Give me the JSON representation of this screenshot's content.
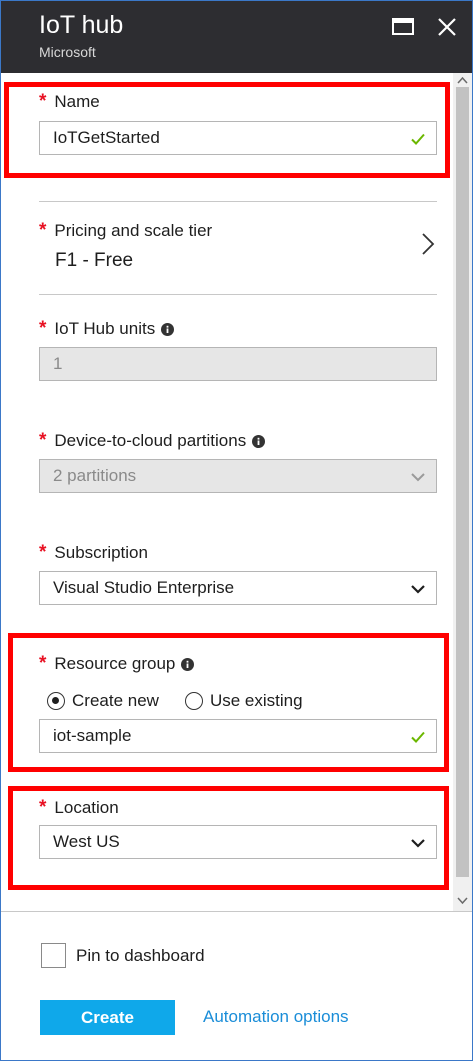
{
  "header": {
    "title": "IoT hub",
    "subtitle": "Microsoft"
  },
  "form": {
    "name": {
      "label": "Name",
      "value": "IoTGetStarted"
    },
    "pricing": {
      "label": "Pricing and scale tier",
      "value": "F1 - Free"
    },
    "units": {
      "label": "IoT Hub units",
      "value": "1"
    },
    "partitions": {
      "label": "Device-to-cloud partitions",
      "value": "2 partitions"
    },
    "subscription": {
      "label": "Subscription",
      "value": "Visual Studio Enterprise"
    },
    "resource_group": {
      "label": "Resource group",
      "option_new": "Create new",
      "option_existing": "Use existing",
      "selected": "Create new",
      "value": "iot-sample"
    },
    "location": {
      "label": "Location",
      "value": "West US"
    }
  },
  "footer": {
    "pin_label": "Pin to dashboard",
    "create_label": "Create",
    "automation_label": "Automation options"
  },
  "colors": {
    "header_bg": "#2d2d31",
    "required": "#e81123",
    "highlight": "#ff0000",
    "primary_button": "#0fa8ea",
    "link": "#1a8dd8",
    "valid_check": "#6bb700"
  }
}
